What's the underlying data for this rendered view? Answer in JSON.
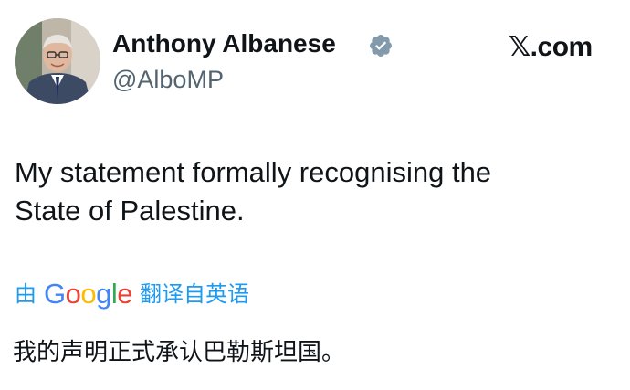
{
  "author": {
    "display_name": "Anthony Albanese",
    "handle": "@AlboMP",
    "verified": true
  },
  "brand": {
    "label": "𝕏.com"
  },
  "tweet": {
    "text_line1": "My statement formally recognising the",
    "text_line2": "State of Palestine."
  },
  "translation": {
    "prefix": "由",
    "provider": {
      "G": "G",
      "o1": "o",
      "o2": "o",
      "g": "g",
      "l": "l",
      "e": "e"
    },
    "suffix": "翻译自英语",
    "text": "我的声明正式承认巴勒斯坦国。"
  },
  "colors": {
    "link_blue": "#1d9bf0",
    "verified_badge": "#829aab",
    "handle_gray": "#536471"
  },
  "icons": {
    "verified": "verified-badge-icon",
    "brand": "x-logo"
  }
}
